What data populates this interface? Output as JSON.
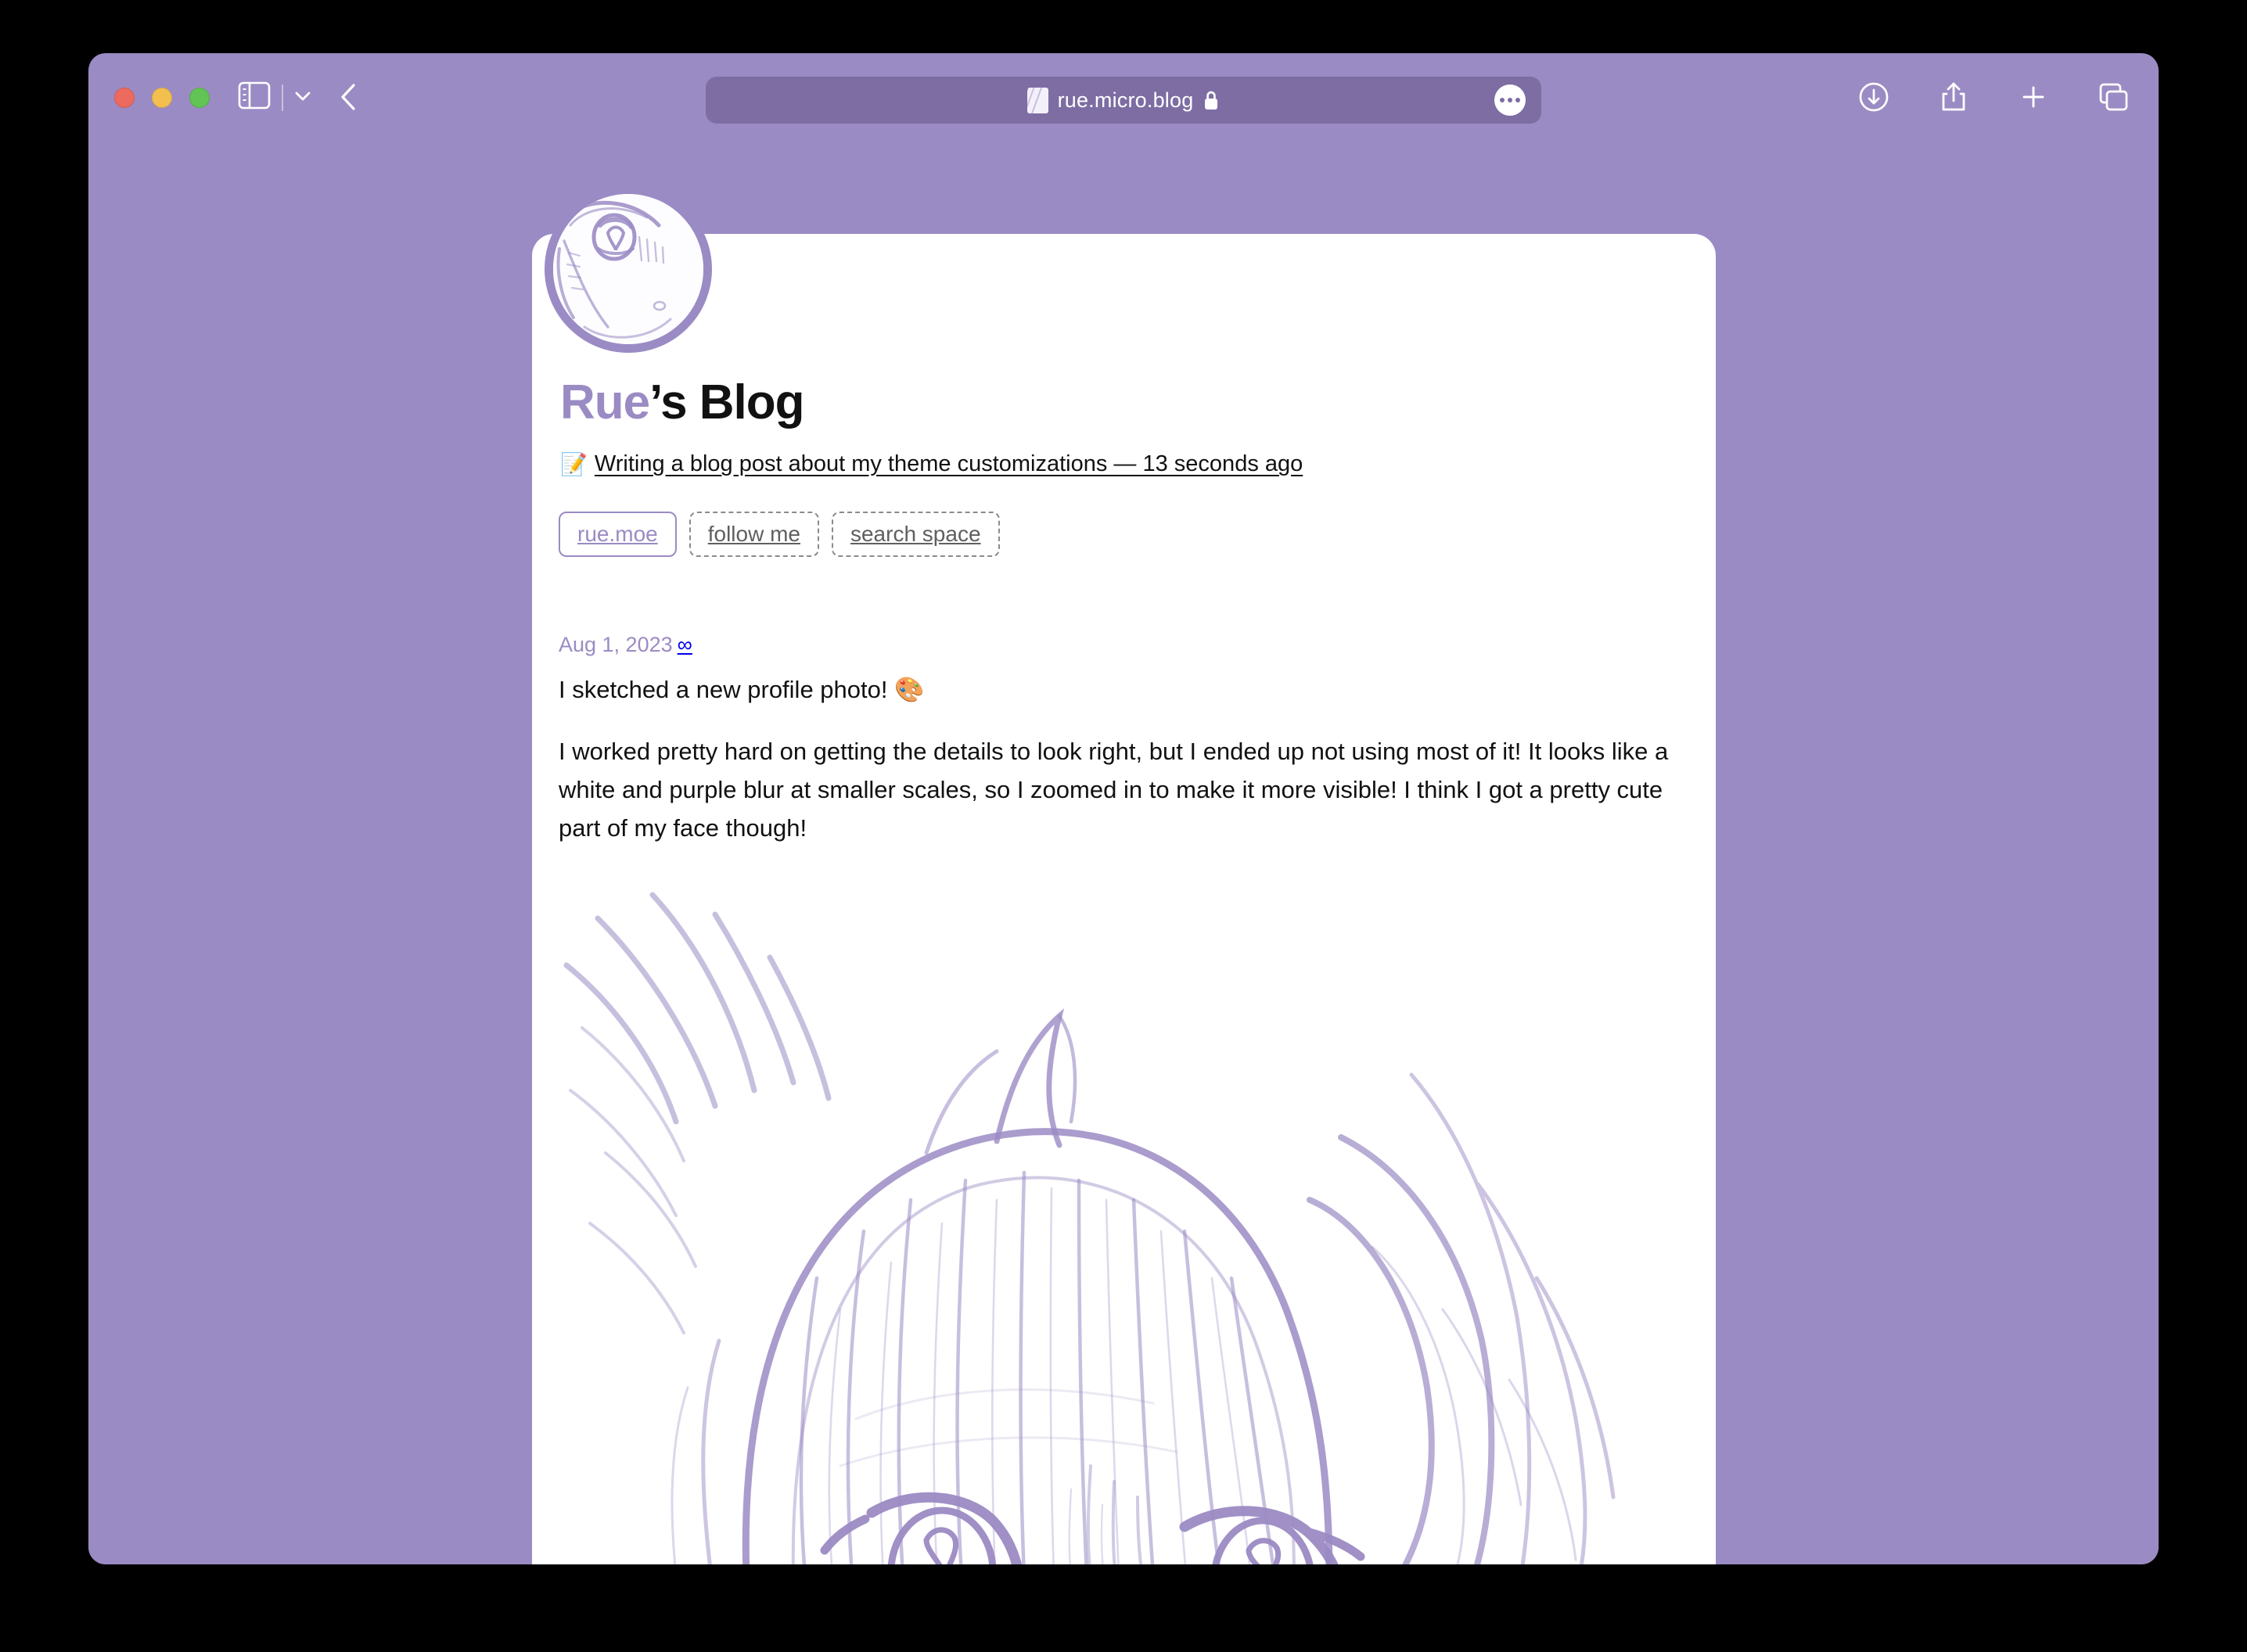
{
  "browser": {
    "traffic_lights": [
      "close",
      "minimize",
      "zoom"
    ],
    "sidebar_toggle": "sidebar-icon",
    "tab_group_chevron": "chevron-down-icon",
    "back_button": "back-chevron-icon",
    "url": "rue.micro.blog",
    "url_secure": true,
    "url_lock_icon": "lock-icon",
    "url_favicon": "site-favicon",
    "url_menu": "ellipsis-icon",
    "right_tools": [
      {
        "name": "downloads-icon",
        "label": "Downloads"
      },
      {
        "name": "share-icon",
        "label": "Share"
      },
      {
        "name": "new-tab-icon",
        "label": "New Tab"
      },
      {
        "name": "tab-overview-icon",
        "label": "Show Tab Overview"
      }
    ]
  },
  "blog": {
    "avatar": "profile-sketch-avatar",
    "title_accent": "Rue",
    "title_rest": "’s Blog",
    "status": {
      "emoji": "📝",
      "text": "Writing a blog post about my theme customizations — 13 seconds ago"
    },
    "nav": [
      {
        "label": "rue.moe",
        "style": "primary"
      },
      {
        "label": "follow me",
        "style": "dashed"
      },
      {
        "label": "search space",
        "style": "dashed"
      }
    ],
    "post": {
      "date": "Aug 1, 2023",
      "permalink": "∞",
      "paragraphs": [
        "I sketched a new profile photo! 🎨",
        "I worked pretty hard on getting the details to look right, but I ended up not using most of it! It looks like a white and purple blur at smaller scales, so I zoomed in to make it more visible! I think I got a pretty cute part of my face though!"
      ],
      "image_alt": "zoomed-in purple line-art sketch of a face with hair and heart-highlight eyes"
    }
  },
  "colors": {
    "chrome_purple": "#9b8bc4",
    "url_pill": "#7d6da3",
    "accent": "#9b8bc4",
    "sketch_line": "#9b8bc4",
    "card": "#ffffff",
    "text": "#111111"
  }
}
